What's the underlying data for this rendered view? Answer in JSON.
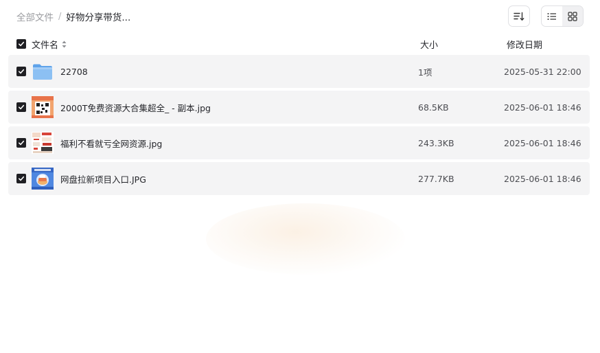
{
  "breadcrumb": {
    "root": "全部文件",
    "separator": "/",
    "current": "好物分享带货..."
  },
  "toolbar": {
    "sort_icon": "sort-icon",
    "list_view_icon": "list-view-icon",
    "grid_view_icon": "grid-view-icon"
  },
  "header": {
    "name": "文件名",
    "size": "大小",
    "date": "修改日期",
    "all_checked": true
  },
  "files": [
    {
      "name": "22708",
      "size": "1项",
      "date": "2025-05-31 22:00",
      "type": "folder",
      "checked": true
    },
    {
      "name": "2000T免费资源大合集超全_ - 副本.jpg",
      "size": "68.5KB",
      "date": "2025-06-01 18:46",
      "type": "image",
      "checked": true
    },
    {
      "name": "福利不看就亏全网资源.jpg",
      "size": "243.3KB",
      "date": "2025-06-01 18:46",
      "type": "image",
      "checked": true
    },
    {
      "name": "网盘拉新项目入口.JPG",
      "size": "277.7KB",
      "date": "2025-06-01 18:46",
      "type": "image",
      "checked": true
    }
  ],
  "colors": {
    "row_bg": "#f4f4f5",
    "checkbox": "#1f1f23",
    "folder": "#7fb6f0"
  }
}
